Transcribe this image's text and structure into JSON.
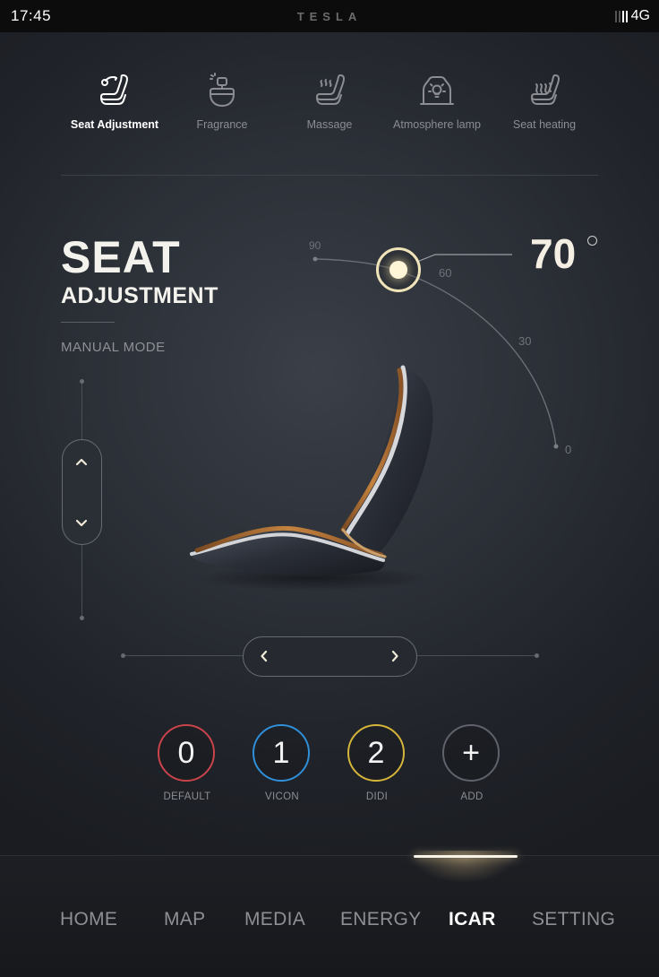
{
  "status_bar": {
    "time": "17:45",
    "brand": "TESLA",
    "network": "4G",
    "signal_level": 0.5
  },
  "features": [
    {
      "label": "Seat  Adjustment",
      "icon": "seat-adjust-icon",
      "active": true
    },
    {
      "label": "Fragrance",
      "icon": "fragrance-icon",
      "active": false
    },
    {
      "label": "Massage",
      "icon": "massage-icon",
      "active": false
    },
    {
      "label": "Atmosphere lamp",
      "icon": "atmosphere-lamp-icon",
      "active": false
    },
    {
      "label": "Seat heating",
      "icon": "seat-heating-icon",
      "active": false
    }
  ],
  "main": {
    "title_line1": "SEAT",
    "title_line2": "ADJUSTMENT",
    "mode": "MANUAL MODE"
  },
  "angle_gauge": {
    "value": "70",
    "ticks": [
      "90",
      "60",
      "30",
      "0"
    ],
    "current_angle": 70
  },
  "presets": [
    {
      "number": "0",
      "label": "DEFAULT",
      "color": "#c8444a"
    },
    {
      "number": "1",
      "label": "VICON",
      "color": "#2f8fd8"
    },
    {
      "number": "2",
      "label": "DIDI",
      "color": "#d4b53a"
    },
    {
      "number": "+",
      "label": "ADD",
      "color": "#5f626a"
    }
  ],
  "nav": {
    "items": [
      {
        "label": "HOME",
        "active": false
      },
      {
        "label": "MAP",
        "active": false
      },
      {
        "label": "MEDIA",
        "active": false
      },
      {
        "label": "ENERGY",
        "active": false
      },
      {
        "label": "ICAR",
        "active": true
      },
      {
        "label": "SETTING",
        "active": false
      }
    ]
  },
  "colors": {
    "accent": "#f4efe2",
    "knob": "#efe3b8",
    "background": "#2a2e35",
    "seat_wood": "#a86a34"
  }
}
